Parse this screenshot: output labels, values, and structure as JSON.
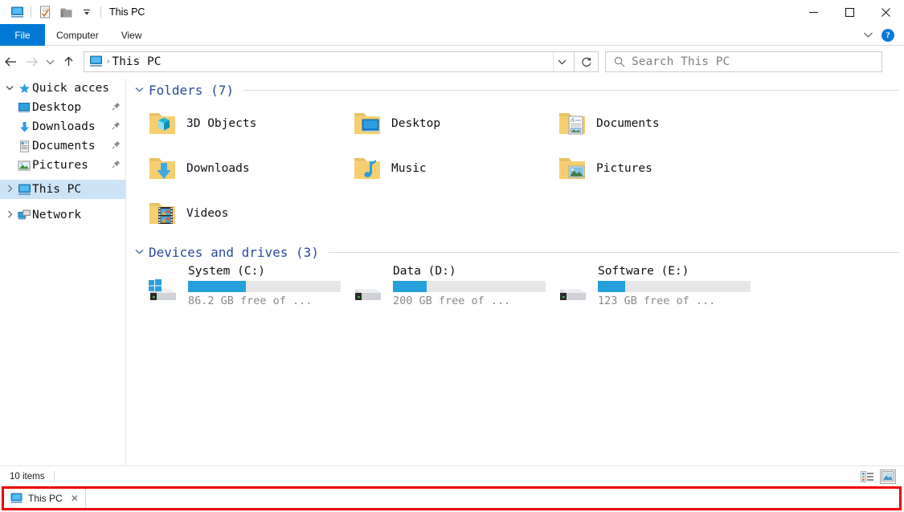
{
  "window": {
    "title": "This PC",
    "quick_access_toolbar": [
      {
        "name": "this-pc-icon",
        "label": "This PC"
      },
      {
        "name": "properties-icon",
        "label": "Properties"
      },
      {
        "name": "new-folder-icon",
        "label": "New folder"
      },
      {
        "name": "customize-chevron-icon",
        "label": "Customize Quick Access Toolbar"
      }
    ],
    "controls": {
      "minimize": "Minimize",
      "maximize": "Maximize",
      "close": "Close"
    }
  },
  "ribbon": {
    "tabs": [
      {
        "label": "File",
        "active": true
      },
      {
        "label": "Computer",
        "active": false
      },
      {
        "label": "View",
        "active": false
      }
    ],
    "collapse_label": "Minimize the Ribbon",
    "help_label": "?"
  },
  "navigation": {
    "back": "Back",
    "forward": "Forward",
    "recent": "Recent locations",
    "up": "Up",
    "address": {
      "icon": "this-pc-icon",
      "separator": "›",
      "path": "This PC",
      "dropdown": "Previous locations"
    },
    "refresh": "Refresh",
    "search": {
      "placeholder": "Search This PC",
      "value": ""
    }
  },
  "sidebar": {
    "items": [
      {
        "label": "Quick acces",
        "icon": "star-icon",
        "chevron": "expanded",
        "indent": false,
        "pinned": false,
        "selected": false
      },
      {
        "label": "Desktop",
        "icon": "desktop-icon",
        "chevron": "none",
        "indent": true,
        "pinned": true,
        "selected": false
      },
      {
        "label": "Downloads",
        "icon": "downloads-icon",
        "chevron": "none",
        "indent": true,
        "pinned": true,
        "selected": false
      },
      {
        "label": "Documents",
        "icon": "documents-icon",
        "chevron": "none",
        "indent": true,
        "pinned": true,
        "selected": false
      },
      {
        "label": "Pictures",
        "icon": "pictures-icon",
        "chevron": "none",
        "indent": true,
        "pinned": true,
        "selected": false
      },
      {
        "label": "This PC",
        "icon": "this-pc-icon",
        "chevron": "collapsed",
        "indent": false,
        "pinned": false,
        "selected": true
      },
      {
        "label": "Network",
        "icon": "network-icon",
        "chevron": "collapsed",
        "indent": false,
        "pinned": false,
        "selected": false
      }
    ]
  },
  "content": {
    "groups": [
      {
        "title": "Folders (7)",
        "chevron": "expanded",
        "items": [
          {
            "label": "3D Objects",
            "icon": "folder-3d-objects-icon"
          },
          {
            "label": "Desktop",
            "icon": "folder-desktop-icon"
          },
          {
            "label": "Documents",
            "icon": "folder-documents-icon"
          },
          {
            "label": "Downloads",
            "icon": "folder-downloads-icon"
          },
          {
            "label": "Music",
            "icon": "folder-music-icon"
          },
          {
            "label": "Pictures",
            "icon": "folder-pictures-icon"
          },
          {
            "label": "Videos",
            "icon": "folder-videos-icon"
          }
        ]
      },
      {
        "title": "Devices and drives (3)",
        "chevron": "expanded",
        "drives": [
          {
            "label": "System (C:)",
            "free_text": "86.2 GB free of ...",
            "used_percent": 38,
            "icon": "windows-drive-icon"
          },
          {
            "label": "Data (D:)",
            "free_text": "200 GB free of ...",
            "used_percent": 22,
            "icon": "drive-icon"
          },
          {
            "label": "Software (E:)",
            "free_text": "123 GB free of ...",
            "used_percent": 18,
            "icon": "drive-icon"
          }
        ]
      }
    ]
  },
  "statusbar": {
    "item_count": "10 items",
    "view_buttons": [
      {
        "name": "details-view-icon",
        "label": "Details view",
        "active": false
      },
      {
        "name": "large-icons-view-icon",
        "label": "Large icons view",
        "active": true
      }
    ]
  },
  "tabstrip": {
    "highlight_color": "#ee0000",
    "tabs": [
      {
        "label": "This PC",
        "icon": "this-pc-icon",
        "close": "✕",
        "active": true
      }
    ]
  },
  "colors": {
    "accent": "#0078d4",
    "selection": "#cce4f7",
    "group_title": "#2a4a9c",
    "progress": "#26a0da",
    "highlight": "#ee0000"
  }
}
